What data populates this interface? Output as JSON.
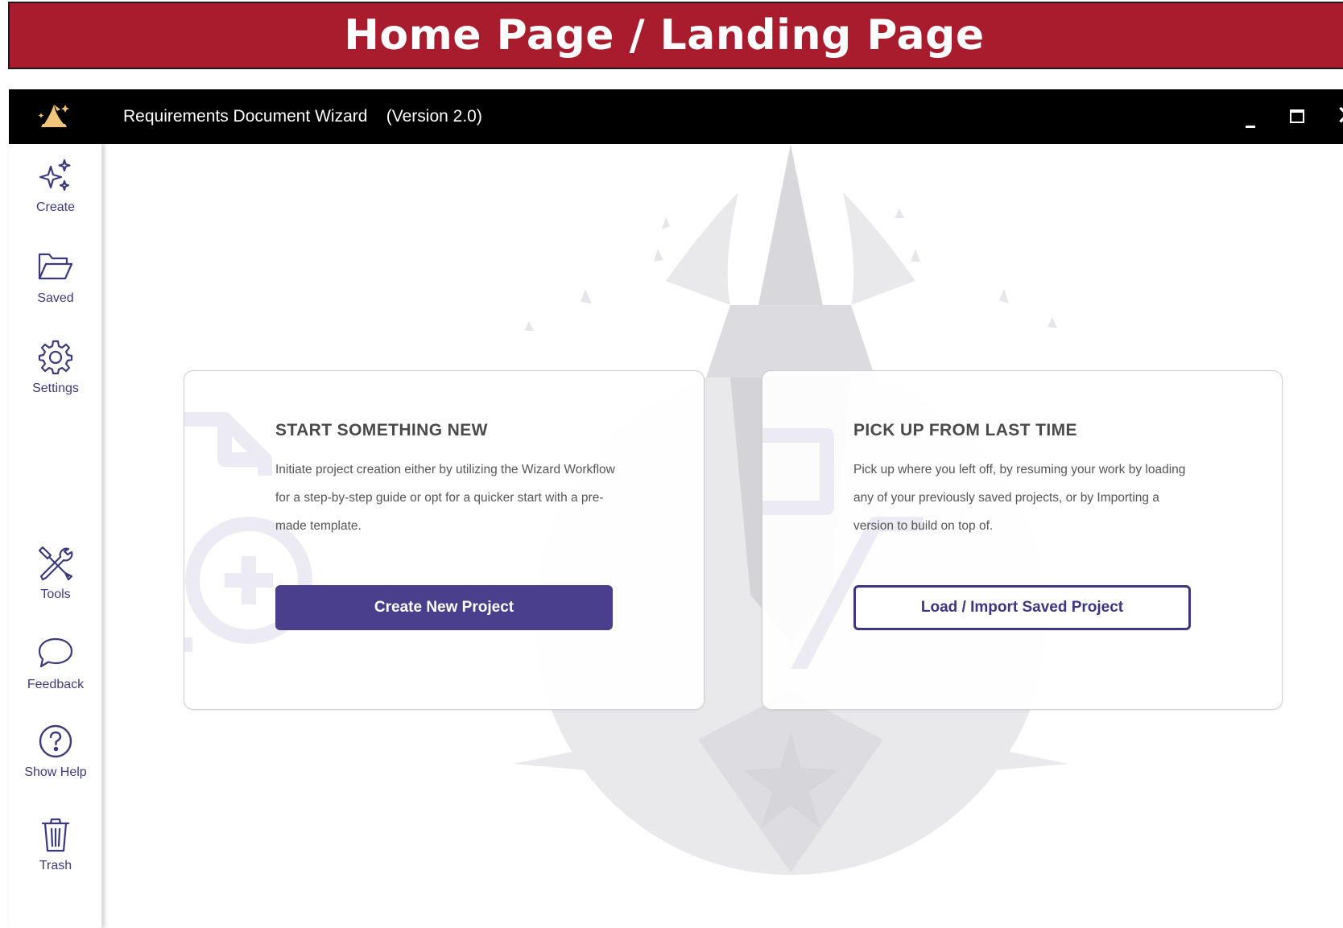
{
  "banner": {
    "title": "Home Page / Landing Page"
  },
  "window": {
    "title": "Requirements Document Wizard    (Version 2.0)",
    "controls": {
      "minimize": "_",
      "maximize": "□",
      "close": "✕"
    }
  },
  "sidebar": {
    "items": [
      {
        "label": "Create",
        "icon": "sparkles-icon"
      },
      {
        "label": "Saved",
        "icon": "folder-icon"
      },
      {
        "label": "Settings",
        "icon": "gear-icon"
      },
      {
        "label": "Tools",
        "icon": "tools-icon"
      },
      {
        "label": "Feedback",
        "icon": "chat-bubble-icon"
      },
      {
        "label": "Show Help",
        "icon": "help-circle-icon"
      },
      {
        "label": "Trash",
        "icon": "trash-icon"
      }
    ]
  },
  "cards": [
    {
      "title": "START SOMETHING NEW",
      "description": "Initiate project creation either by utilizing the Wizard Workflow for a step-by-step guide or opt for a quicker start with a pre-made template.",
      "button": "Create New Project"
    },
    {
      "title": "PICK UP FROM LAST TIME",
      "description": "Pick up where you left off, by resuming your work by loading any of your previously saved projects, or by Importing a version to build on top of.",
      "button": "Load / Import Saved Project"
    }
  ],
  "colors": {
    "banner": "#a81c2d",
    "titlebar": "#000000",
    "accent": "#4a3f8c",
    "sidebar_text": "#3d3a7a"
  }
}
